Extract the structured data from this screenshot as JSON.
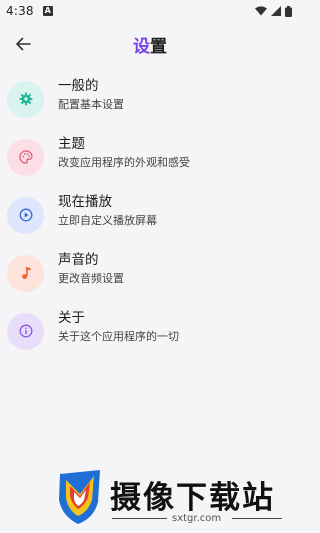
{
  "status_bar": {
    "time": "4:38"
  },
  "header": {
    "back_icon": "arrow-left-icon",
    "title_part1": "设",
    "title_part2": "置"
  },
  "settings": [
    {
      "title": "一般的",
      "subtitle": "配置基本设置",
      "icon": "gear-icon",
      "bg": "#d9f3ee",
      "fg": "#21b79a"
    },
    {
      "title": "主题",
      "subtitle": "改变应用程序的外观和感受",
      "icon": "palette-icon",
      "bg": "#fcdfe6",
      "fg": "#e0607a"
    },
    {
      "title": "现在播放",
      "subtitle": "立即自定义播放屏幕",
      "icon": "play-circle-icon",
      "bg": "#dde6fb",
      "fg": "#3a67d8"
    },
    {
      "title": "声音的",
      "subtitle": "更改音频设置",
      "icon": "music-note-icon",
      "bg": "#fde3da",
      "fg": "#ef5f2e"
    },
    {
      "title": "关于",
      "subtitle": "关于这个应用程序的一切",
      "icon": "info-icon",
      "bg": "#e9defa",
      "fg": "#8a55e0"
    }
  ],
  "watermark": {
    "text": "摄像下载站",
    "url": "sxtgr.com"
  },
  "colors": {
    "accent": "#7a3fe6",
    "background": "#f5f5f8"
  }
}
